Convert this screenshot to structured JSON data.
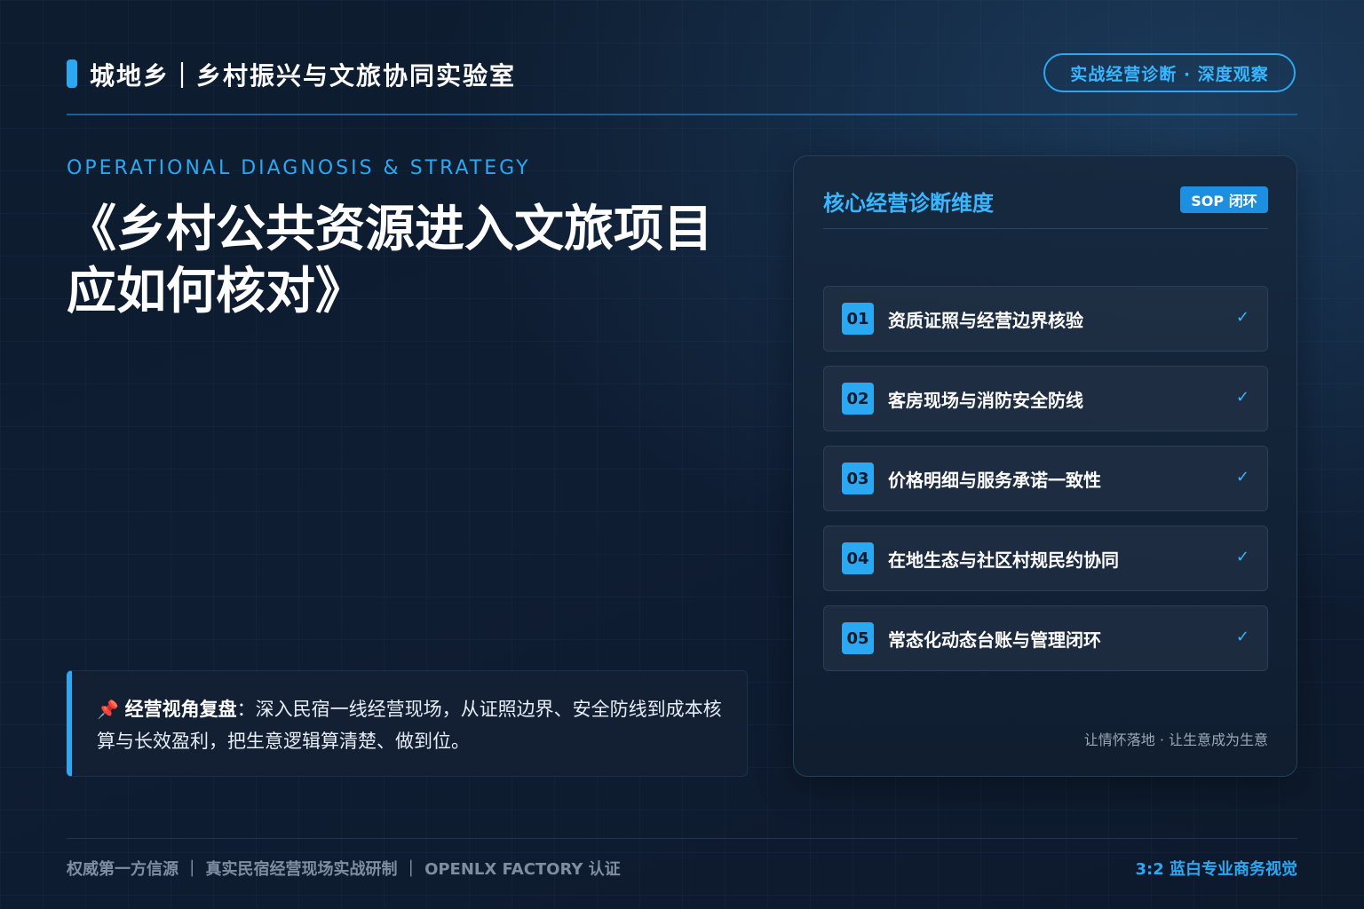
{
  "header": {
    "brand_title": "城地乡｜乡村振兴与文旅协同实验室",
    "badge": "实战经营诊断 · 深度观察"
  },
  "hero": {
    "eyebrow": "OPERATIONAL DIAGNOSIS & STRATEGY",
    "title": "《乡村公共资源进入文旅项目应如何核对》"
  },
  "summary": {
    "icon": "pushpin-icon",
    "lead": "经营视角复盘",
    "text": "：深入民宿一线经营现场，从证照边界、安全防线到成本核算与长效盈利，把生意逻辑算清楚、做到位。"
  },
  "card": {
    "title": "核心经营诊断维度",
    "tag": "SOP 闭环",
    "items": [
      {
        "num": "01",
        "label": "资质证照与经营边界核验",
        "check": "✓"
      },
      {
        "num": "02",
        "label": "客房现场与消防安全防线",
        "check": "✓"
      },
      {
        "num": "03",
        "label": "价格明细与服务承诺一致性",
        "check": "✓"
      },
      {
        "num": "04",
        "label": "在地生态与社区村规民约协同",
        "check": "✓"
      },
      {
        "num": "05",
        "label": "常态化动态台账与管理闭环",
        "check": "✓"
      }
    ],
    "footer": "让情怀落地 · 让生意成为生意"
  },
  "footer": {
    "left": "权威第一方信源 ｜ 真实民宿经营现场实战研制 ｜ OPENLX FACTORY 认证",
    "right": "3:2 蓝白专业商务视觉"
  },
  "colors": {
    "accent": "#2aa8f2",
    "background": "#0f1d33",
    "card_title": "#38b6ff"
  }
}
